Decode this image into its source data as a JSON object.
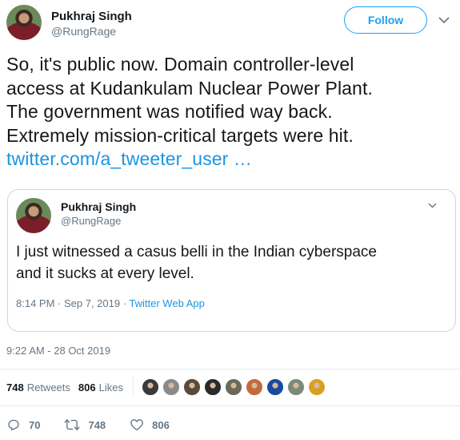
{
  "author": {
    "name": "Pukhraj Singh",
    "handle": "@RungRage",
    "follow_label": "Follow"
  },
  "tweet": {
    "text_line1": "So, it's public now. Domain controller-level",
    "text_line2": "access at Kudankulam Nuclear Power Plant.",
    "text_line3": "The government was notified way back.",
    "text_line4": "Extremely mission-critical targets were hit.",
    "link": "twitter.com/a_tweeter_user …"
  },
  "quoted": {
    "name": "Pukhraj Singh",
    "handle": "@RungRage",
    "text_line1": "I just witnessed a casus belli in the Indian cyberspace",
    "text_line2": "and it sucks at every level.",
    "time": "8:14 PM · Sep 7, 2019 · ",
    "source": "Twitter Web App"
  },
  "timestamp": "9:22 AM - 28 Oct 2019",
  "stats": {
    "retweets_count": "748",
    "retweets_label": "Retweets",
    "likes_count": "806",
    "likes_label": "Likes"
  },
  "likers": [
    "#3a3a3a",
    "#8a8a8a",
    "#5a4a3a",
    "#2a2a2a",
    "#6a6a5a",
    "#c46a3a",
    "#1a4aa0",
    "#7a8a7a",
    "#d8a020"
  ],
  "actions": {
    "replies": "70",
    "retweets": "748",
    "likes": "806"
  },
  "colors": {
    "accent": "#1da1f2",
    "link": "#1b95e0",
    "muted": "#657786"
  }
}
